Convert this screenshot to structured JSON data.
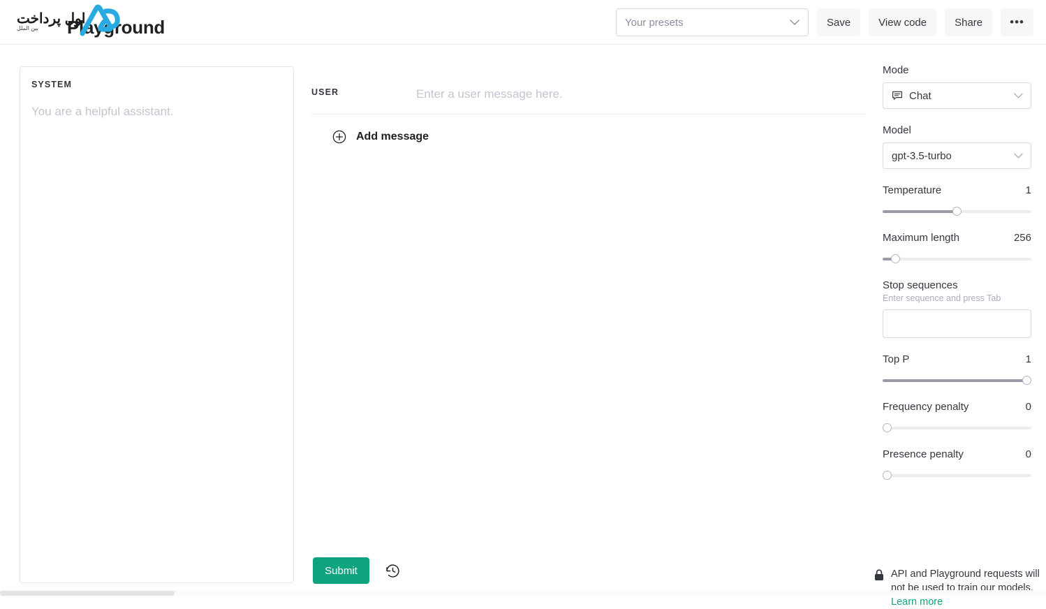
{
  "header": {
    "brand_title": "Playground",
    "watermark": {
      "title_fa": "اول پرداخت",
      "subtitle_fa": "بین الملل"
    },
    "presets": {
      "placeholder": "Your presets",
      "caret_icon": "chevron-down-icon"
    },
    "buttons": [
      {
        "label": "Save",
        "name": "save-button"
      },
      {
        "label": "View code",
        "name": "view-code-button"
      },
      {
        "label": "Share",
        "name": "share-button"
      },
      {
        "label": "•••",
        "name": "more-options-button"
      }
    ]
  },
  "system": {
    "label": "SYSTEM",
    "placeholder": "You are a helpful assistant."
  },
  "conversation": {
    "user_label": "USER",
    "user_placeholder": "Enter a user message here.",
    "add_message_label": "Add message",
    "add_message_icon": "plus-circle-icon"
  },
  "actions": {
    "submit_label": "Submit",
    "history_icon": "history-icon",
    "accent_color": "#10a37f"
  },
  "sidebar": {
    "mode": {
      "label": "Mode",
      "value": "Chat",
      "icon": "chat-bubble-icon",
      "caret_icon": "chevron-down-icon"
    },
    "model": {
      "label": "Model",
      "value": "gpt-3.5-turbo",
      "caret_icon": "chevron-down-icon"
    },
    "parameters": [
      {
        "name": "Temperature",
        "value": "1",
        "percent": 50
      },
      {
        "name": "Maximum length",
        "value": "256",
        "percent": 6
      }
    ],
    "stop_sequences": {
      "title": "Stop sequences",
      "hint": "Enter sequence and press Tab",
      "value": ""
    },
    "parameters2": [
      {
        "name": "Top P",
        "value": "1",
        "percent": 100
      },
      {
        "name": "Frequency penalty",
        "value": "0",
        "percent": 0
      },
      {
        "name": "Presence penalty",
        "value": "0",
        "percent": 0
      }
    ],
    "privacy": {
      "icon": "lock-icon",
      "text": "API and Playground requests will not be used to train our models. ",
      "link": "Learn more"
    }
  }
}
